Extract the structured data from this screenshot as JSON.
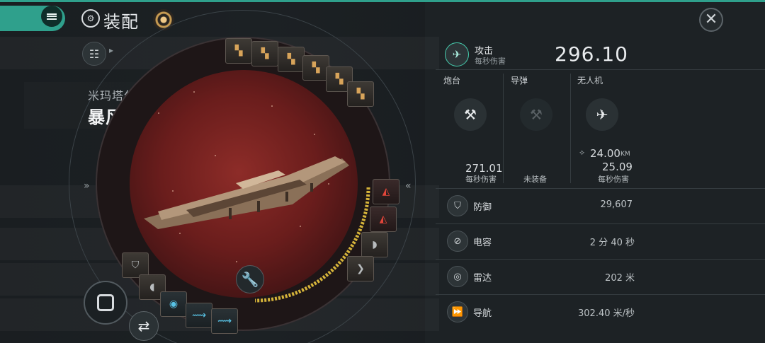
{
  "header": {
    "title": "装配",
    "menu_icon": "menu-icon",
    "fit_icon": "fitting-icon",
    "skill_icon": "skill-icon",
    "close_icon": "close-icon"
  },
  "ship": {
    "faction": "米玛塔尔",
    "name": "暴风级原型",
    "name_arrow": "»"
  },
  "nav": {
    "left_chevron": "»",
    "right_chevron": "«"
  },
  "attack": {
    "label": "攻击",
    "sub": "每秒伤害",
    "value": "296.10"
  },
  "weapons": {
    "turret": {
      "title": "炮台",
      "value": "271.01",
      "sub": "每秒伤害"
    },
    "missile": {
      "title": "导弹",
      "status": "未装备"
    },
    "drone": {
      "title": "无人机",
      "range": "24.00",
      "range_unit": "KM",
      "value": "25.09",
      "sub": "每秒伤害"
    }
  },
  "stats": [
    {
      "label": "防御",
      "value": "29,607",
      "icon": "shield-icon"
    },
    {
      "label": "电容",
      "value": "2 分 40 秒",
      "icon": "capacitor-icon"
    },
    {
      "label": "雷达",
      "value": "202 米",
      "icon": "radar-icon"
    },
    {
      "label": "导航",
      "value": "302.40 米/秒",
      "icon": "navigation-icon"
    }
  ],
  "colors": {
    "accent": "#2fa08c",
    "slot_gold": "#d8a45a",
    "drone_red": "#e0453a",
    "low_slot_cyan": "#58c3e6",
    "capacitor_yellow": "#d6b43a"
  }
}
